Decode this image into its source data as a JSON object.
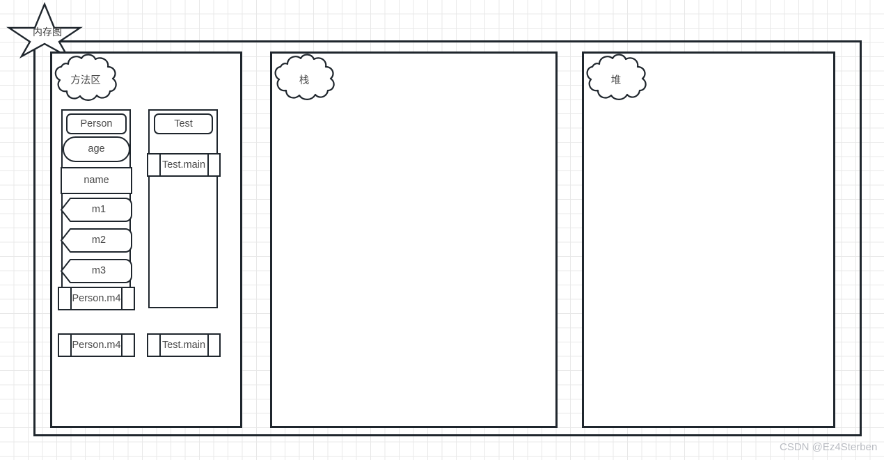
{
  "diagram": {
    "title_badge": "内存图",
    "watermark": "CSDN @Ez4Sterben",
    "colors": {
      "stroke": "#1f262d",
      "text": "#4a4a4a",
      "grid": "#e8e8e8",
      "background": "#ffffff",
      "watermark": "#b9bcc2"
    },
    "regions": [
      {
        "id": "method-area",
        "cloud_label": "方法区"
      },
      {
        "id": "stack",
        "cloud_label": "栈"
      },
      {
        "id": "heap",
        "cloud_label": "堆"
      }
    ],
    "method_area": {
      "class_boxes": [
        {
          "id": "person-class",
          "header": {
            "label": "Person",
            "shape": "rounded-rect"
          },
          "members": [
            {
              "label": "age",
              "shape": "stadium"
            },
            {
              "label": "name",
              "shape": "rectangle"
            },
            {
              "label": "m1",
              "shape": "notched-arrow"
            },
            {
              "label": "m2",
              "shape": "notched-arrow"
            },
            {
              "label": "m3",
              "shape": "notched-arrow"
            }
          ],
          "footer": {
            "label": "Person.m4",
            "shape": "process"
          }
        },
        {
          "id": "test-class",
          "header": {
            "label": "Test",
            "shape": "rounded-rect"
          },
          "members": [
            {
              "label": "Test.main",
              "shape": "process"
            }
          ],
          "footer": null
        }
      ],
      "bottom_row": [
        {
          "label": "Person.m4",
          "shape": "process"
        },
        {
          "label": "Test.main",
          "shape": "process"
        }
      ]
    },
    "stack": {
      "items": []
    },
    "heap": {
      "items": []
    }
  }
}
